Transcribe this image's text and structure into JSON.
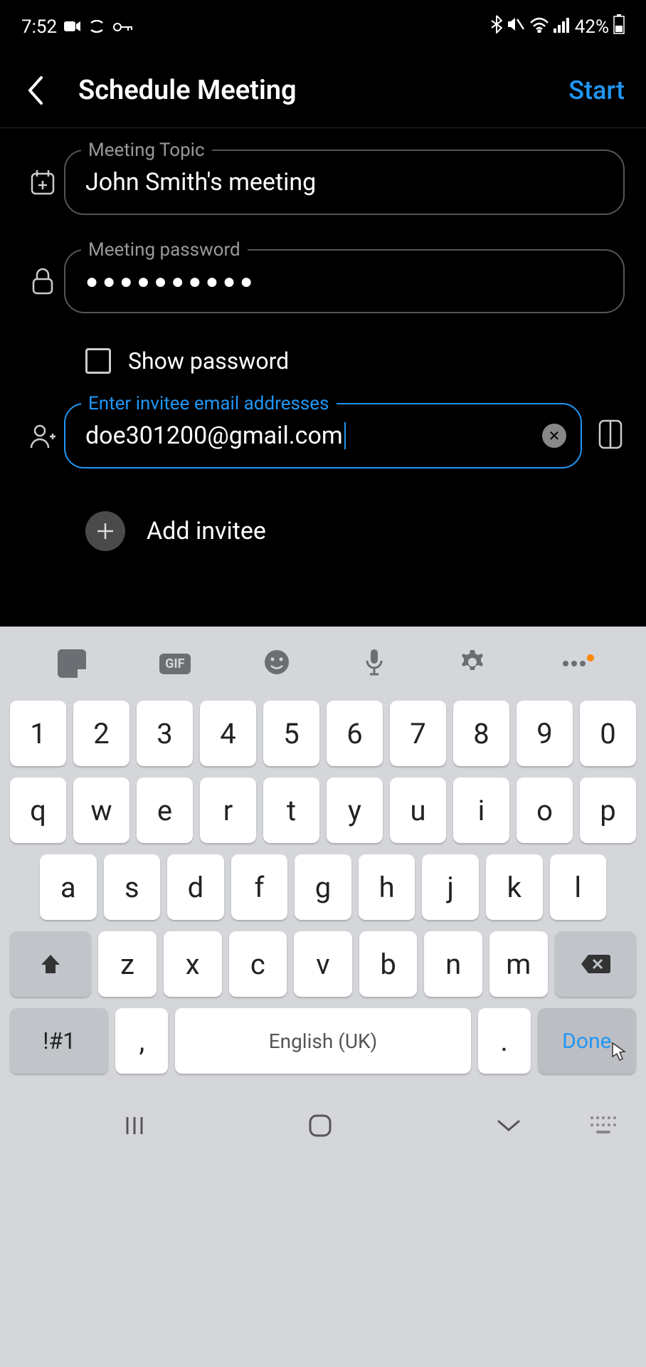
{
  "status": {
    "time": "7:52",
    "battery_text": "42%"
  },
  "header": {
    "title": "Schedule Meeting",
    "action": "Start"
  },
  "form": {
    "topic_label": "Meeting Topic",
    "topic_value": "John Smith's meeting",
    "password_label": "Meeting password",
    "password_masked": "●●●●●●●●●●",
    "show_password_label": "Show password",
    "show_password_checked": false,
    "invitee_label": "Enter invitee email addresses",
    "invitee_value": "doe301200@gmail.com",
    "add_invitee_label": "Add invitee"
  },
  "keyboard": {
    "row1": [
      "1",
      "2",
      "3",
      "4",
      "5",
      "6",
      "7",
      "8",
      "9",
      "0"
    ],
    "row2": [
      "q",
      "w",
      "e",
      "r",
      "t",
      "y",
      "u",
      "i",
      "o",
      "p"
    ],
    "row3": [
      "a",
      "s",
      "d",
      "f",
      "g",
      "h",
      "j",
      "k",
      "l"
    ],
    "row4": [
      "z",
      "x",
      "c",
      "v",
      "b",
      "n",
      "m"
    ],
    "symbol_key": "!#1",
    "comma_key": ",",
    "period_key": ".",
    "space_label": "English (UK)",
    "done_label": "Done"
  }
}
